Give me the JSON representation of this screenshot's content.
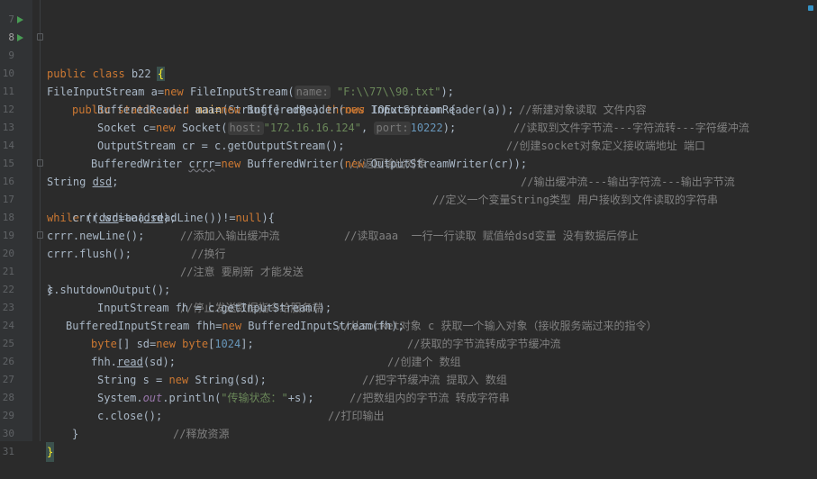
{
  "editor": {
    "lines": [
      {
        "number": "7",
        "partial": true
      },
      {
        "number": "8"
      },
      {
        "number": "9"
      },
      {
        "number": "10"
      },
      {
        "number": "11"
      },
      {
        "number": "12"
      },
      {
        "number": "13"
      },
      {
        "number": "14"
      },
      {
        "number": "15"
      },
      {
        "number": "16"
      },
      {
        "number": "17"
      },
      {
        "number": "18"
      },
      {
        "number": "19"
      },
      {
        "number": "20"
      },
      {
        "number": "21"
      },
      {
        "number": "22"
      },
      {
        "number": "23"
      },
      {
        "number": "24"
      },
      {
        "number": "25"
      },
      {
        "number": "26"
      },
      {
        "number": "27"
      },
      {
        "number": "28"
      },
      {
        "number": "29"
      },
      {
        "number": "30"
      },
      {
        "number": "31"
      }
    ],
    "code": {
      "l8": {
        "kw1": "public class",
        "name": " b22 ",
        "brace": "{"
      },
      "l9": {
        "kw1": "public static void",
        "fn": "main",
        "rest": "(String[] args) ",
        "kw2": "throws",
        "rest2": " IOException {"
      },
      "l10": {
        "a": "FileInputStream a=",
        "kw": "new",
        "b": " FileInputStream(",
        "hint": "name:",
        "str": "\"F:\\\\77\\\\90.txt\"",
        "c": ");",
        "cmt": "//新建对象读取 文件内容"
      },
      "l11": {
        "a": "BufferedReader aaa=",
        "kw": "new",
        "b": " BufferedReader(",
        "kw2": "new",
        "c": " InputStreamReader(a));",
        "cmt": "//读取到文件字节流---字符流转---字符缓冲流"
      },
      "l12": {
        "a": "Socket c=",
        "kw": "new",
        "b": " Socket(",
        "hint1": "host:",
        "str": "\"172.16.16.124\"",
        "comma": ", ",
        "hint2": "port:",
        "num": "10222",
        "c": ");",
        "cmt": "//创建socket对象定义接收端地址 端口"
      },
      "l13": {
        "a": "OutputStream cr = c.getOutputStream();",
        "cmt": "//返回输出对象"
      },
      "l14": {
        "a": "BufferedWriter ",
        "warn": "crrr",
        "b": "=",
        "kw": "new",
        "c": " BufferedWriter(",
        "kw2": "new",
        "d": " OutputStreamWriter(cr));",
        "cmt": "//输出缓冲流---输出字符流---输出字节流"
      },
      "l15": {
        "a": "String ",
        "und": "dsd",
        "b": ";",
        "cmt": "//定义一个变量String类型 用户接收到文件读取的字符串"
      },
      "l16": {
        "kw": "while",
        "a": " ((",
        "und": "dsd",
        "b": "=aaa.readLine())!=",
        "kw2": "null",
        "c": "){",
        "cmt": "//读取aaa  一行一行读取 赋值给dsd变量 没有数据后停止"
      },
      "l17": {
        "a": "crrr.write(",
        "und": "dsd",
        "b": ");",
        "cmt": "//添加入输出缓冲流"
      },
      "l18": {
        "a": "crrr.newLine();",
        "cmt": "//换行"
      },
      "l19": {
        "a": "crrr.flush();",
        "cmt": "//注意 要刷新 才能发送"
      },
      "l20": {
        "a": "}"
      },
      "l21": {
        "a": "c.shutdownOutput();",
        "cmt": "//停止发送数据指令给服务端"
      },
      "l22": {
        "a": "InputStream fh = c.getInputStream();",
        "cmt": "//从socket对象 c 获取一个输入对象（接收服务端过来的指令）"
      },
      "l23": {
        "a": "BufferedInputStream fhh=",
        "kw": "new",
        "b": " BufferedInputStream(fh);",
        "cmt": "//获取的字节流转成字节缓冲流"
      },
      "l24": {
        "kw": "byte",
        "a": "[] sd=",
        "kw2": "new",
        "kw3": " byte",
        "b": "[",
        "num": "1024",
        "c": "];",
        "cmt": "//创建个 数组"
      },
      "l25": {
        "a": "fhh.",
        "und": "read",
        "b": "(sd);",
        "cmt": "//把字节缓冲流 提取入 数组"
      },
      "l26": {
        "a": "String s = ",
        "kw": "new",
        "b": " String(sd);",
        "cmt": "//把数组内的字节流 转成字符串"
      },
      "l27": {
        "a": "System.",
        "fld": "out",
        "b": ".println(",
        "str": "\"传输状态：\"",
        "c": "+s);",
        "cmt": "//打印输出"
      },
      "l28": {
        "a": "c.close();",
        "cmt": "//释放资源"
      },
      "l29": {
        "a": "}"
      },
      "l30": {
        "a": "}"
      }
    }
  },
  "colors": {
    "background": "#2b2b2b",
    "gutter": "#313335",
    "keyword": "#cc7832",
    "string": "#6a8759",
    "number": "#6897bb",
    "comment": "#808080",
    "method": "#ffc66d",
    "static_field": "#9876aa",
    "run_icon": "#499c54"
  },
  "icons": {
    "run": "run-gutter-icon",
    "fold": "fold-marker-icon"
  }
}
